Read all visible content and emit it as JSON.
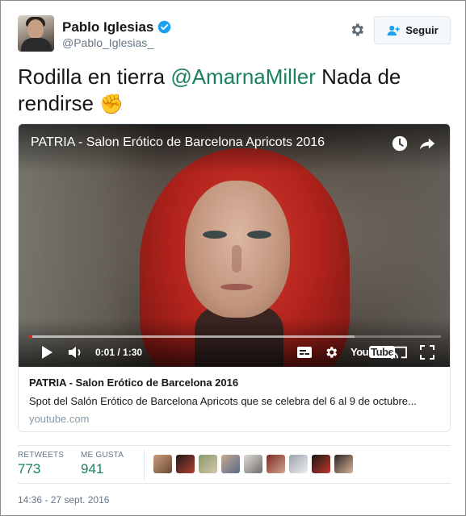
{
  "user": {
    "name": "Pablo Iglesias",
    "handle": "@Pablo_Iglesias_",
    "verified": true
  },
  "actions": {
    "follow_label": "Seguir"
  },
  "tweet": {
    "text_before": "Rodilla en tierra ",
    "mention": "@AmarnaMiller",
    "text_after": " Nada de rendirse ",
    "emoji": "✊"
  },
  "video": {
    "title": "PATRIA - Salon Erótico de Barcelona Apricots 2016",
    "time": "0:01 / 1:30",
    "progress_played": 0.01,
    "progress_loaded": 0.79,
    "logo_you": "You",
    "logo_tube": "Tube"
  },
  "card": {
    "title": "PATRIA - Salon Erótico de Barcelona 2016",
    "description": "Spot del Salón Erótico de Barcelona Apricots que se celebra del 6 al 9 de octubre...",
    "domain": "youtube.com"
  },
  "stats": {
    "retweets_label": "RETWEETS",
    "retweets_value": "773",
    "likes_label": "ME GUSTA",
    "likes_value": "941"
  },
  "likers": [
    {
      "name": "liker-avatar-1",
      "color1": "#c89c78",
      "color2": "#6b4a3a"
    },
    {
      "name": "liker-avatar-2",
      "color1": "#1f1b1a",
      "color2": "#b0402e"
    },
    {
      "name": "liker-avatar-3",
      "color1": "#8a9a6e",
      "color2": "#d2c6a8"
    },
    {
      "name": "liker-avatar-4",
      "color1": "#c8a890",
      "color2": "#5a6b8a"
    },
    {
      "name": "liker-avatar-5",
      "color1": "#e0ddd8",
      "color2": "#6e6c6a"
    },
    {
      "name": "liker-avatar-6",
      "color1": "#7a2a24",
      "color2": "#d4a58e"
    },
    {
      "name": "liker-avatar-7",
      "color1": "#9aa2ab",
      "color2": "#eef0f2"
    },
    {
      "name": "liker-avatar-8",
      "color1": "#1a1616",
      "color2": "#c0392b"
    },
    {
      "name": "liker-avatar-9",
      "color1": "#2a2220",
      "color2": "#d6b49a"
    }
  ],
  "timestamp": "14:36 - 27 sept. 2016",
  "colors": {
    "mention": "#1b8060",
    "stat_value": "#1b8060",
    "verified": "#1da1f2",
    "progress_played": "#e62117"
  }
}
